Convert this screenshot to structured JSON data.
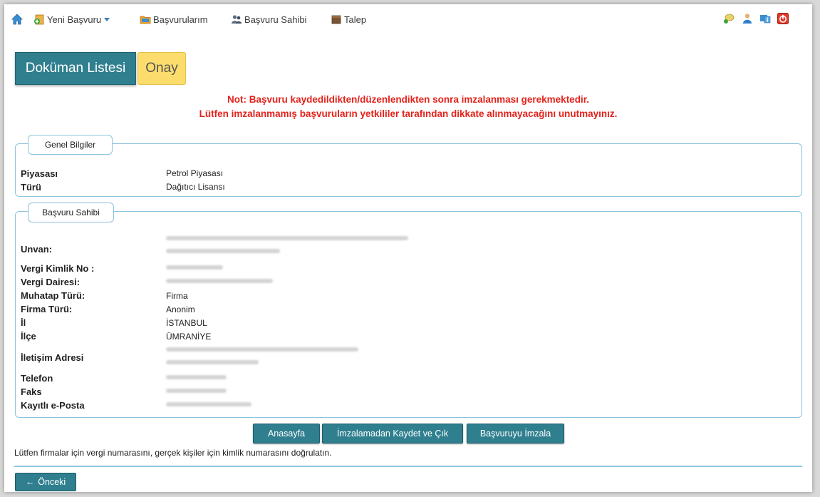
{
  "nav": {
    "items": [
      {
        "label": "Yeni Başvuru"
      },
      {
        "label": "Başvurularım"
      },
      {
        "label": "Başvuru Sahibi"
      },
      {
        "label": "Talep"
      }
    ]
  },
  "tabs": {
    "documents": "Doküman Listesi",
    "approve": "Onay"
  },
  "notice": {
    "line1": "Not: Başvuru kaydedildikten/düzenlendikten sonra imzalanması gerekmektedir.",
    "line2": "Lütfen imzalanmamış başvuruların yetkililer tarafından dikkate alınmayacağını unutmayınız."
  },
  "general": {
    "legend": "Genel Bilgiler",
    "rows": [
      {
        "label": "Piyasası",
        "value": "Petrol Piyasası"
      },
      {
        "label": "Türü",
        "value": "Dağıtıcı Lisansı"
      }
    ]
  },
  "applicant": {
    "legend": "Başvuru Sahibi",
    "rows": [
      {
        "label": "Unvan:",
        "value": ""
      },
      {
        "label": "Vergi Kimlik No :",
        "value": ""
      },
      {
        "label": "Vergi Dairesi:",
        "value": ""
      },
      {
        "label": "Muhatap Türü:",
        "value": "Firma"
      },
      {
        "label": "Firma Türü:",
        "value": "Anonim"
      },
      {
        "label": "İl",
        "value": "İSTANBUL"
      },
      {
        "label": "İlçe",
        "value": "ÜMRANİYE"
      },
      {
        "label": "İletişim Adresi",
        "value": ""
      },
      {
        "label": "Telefon",
        "value": ""
      },
      {
        "label": "Faks",
        "value": ""
      },
      {
        "label": "Kayıtlı e-Posta",
        "value": ""
      }
    ]
  },
  "buttons": {
    "home": "Anasayfa",
    "save_exit": "İmzalamadan Kaydet ve Çık",
    "sign": "Başvuruyu İmzala",
    "prev": "Önceki"
  },
  "footnote": "Lütfen firmalar için vergi numarasını, gerçek kişiler için kimlik numarasını doğrulatın.",
  "colors": {
    "accent": "#2f7f8f",
    "warning": "#e4221b",
    "onay_tab": "#fbdc6c",
    "border": "#8cc3dc"
  }
}
